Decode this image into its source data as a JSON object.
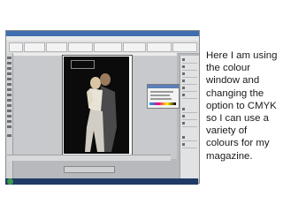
{
  "caption": {
    "lines": [
      "Here I am using",
      "the colour",
      "window and",
      "changing the",
      "option to CMYK",
      "so I can use a",
      "variety of",
      "colours for my",
      "magazine."
    ]
  },
  "screenshot": {
    "application": "page layout editor",
    "icons": [
      "toolbox-icons",
      "panel-icons",
      "start-button-icon"
    ],
    "colors": {
      "titlebar": "#3f6fb0",
      "taskbar": "#203a66",
      "pasteboard": "#c7c9cc",
      "photo_bg": "#0b0b0b"
    }
  }
}
